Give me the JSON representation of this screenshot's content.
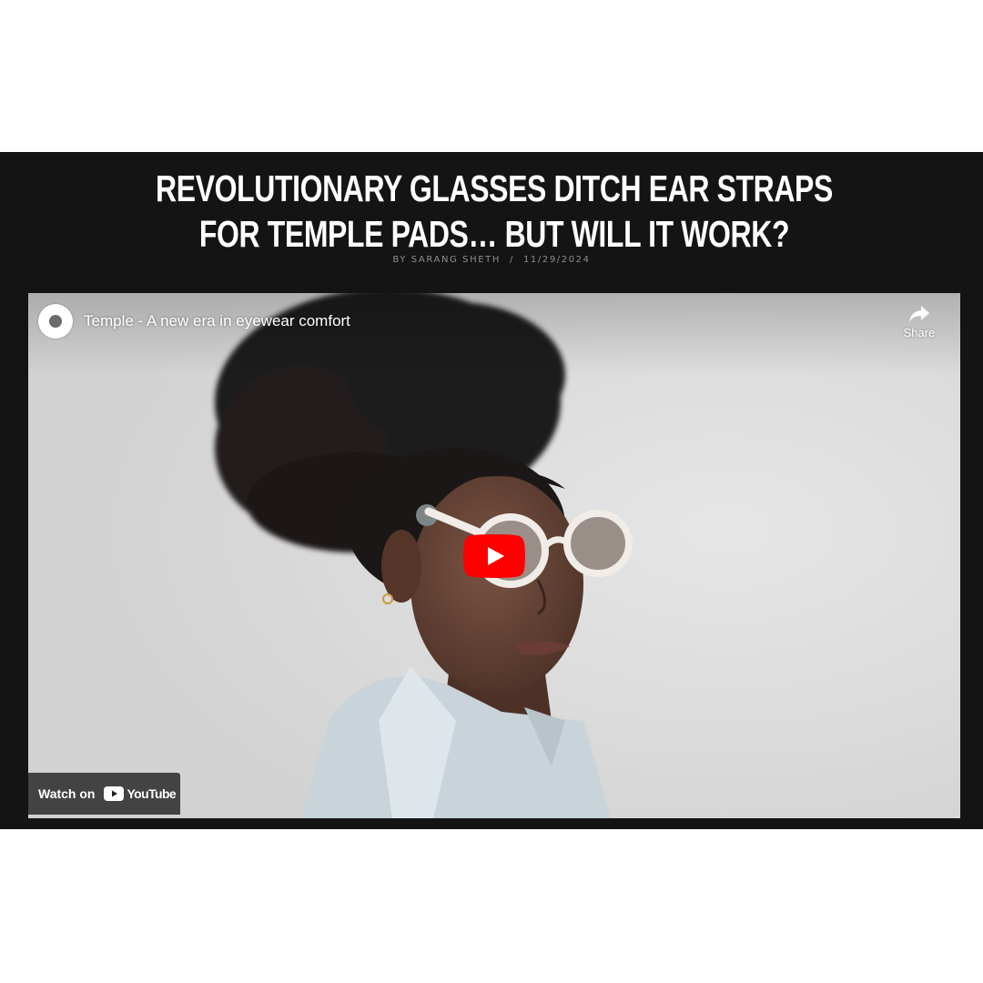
{
  "article": {
    "headline": "REVOLUTIONARY GLASSES DITCH EAR STRAPS FOR TEMPLE PADS… BUT WILL IT WORK?",
    "author": "BY SARANG SHETH",
    "separator": "/",
    "date": "11/29/2024"
  },
  "player": {
    "video_title": "Temple - A new era in eyewear comfort",
    "share_label": "Share",
    "watch_on_label": "Watch on",
    "brand_label": "YouTube",
    "play_icon": "play-icon",
    "share_icon": "share-arrow-icon"
  },
  "colors": {
    "band": "#141414",
    "youtube_red": "#ff0000",
    "byline": "#8e8e8e"
  }
}
